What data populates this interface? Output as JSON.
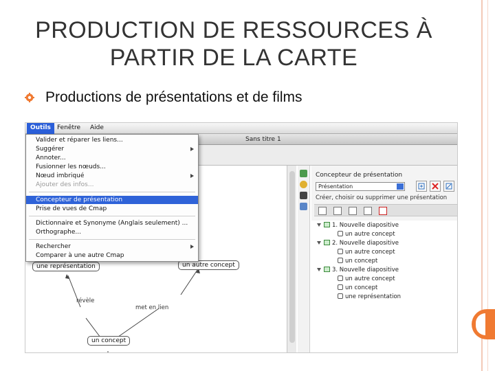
{
  "slide": {
    "title": "PRODUCTION DE RESSOURCES À PARTIR DE LA CARTE",
    "bullet": "Productions de présentations et de films",
    "accent_color": "#f07a32"
  },
  "app": {
    "menubar": {
      "items": [
        "Outils",
        "Fenêtre",
        "Aide"
      ]
    },
    "window_title": "Sans titre 1",
    "tools_menu": {
      "items": [
        "Valider et réparer les liens...",
        "Suggérer",
        "Annoter...",
        "Fusionner les nœuds...",
        "Nœud imbriqué",
        "Ajouter des infos...",
        "Concepteur de présentation",
        "Prise de vues de Cmap",
        "Dictionnaire et Synonyme (Anglais seulement) ...",
        "Orthographe...",
        "Rechercher",
        "Comparer à une autre Cmap"
      ]
    },
    "map": {
      "node_representation": "une représentation",
      "node_autre": "un autre concept",
      "node_concept": "un concept",
      "link_revele": "révèle",
      "link_met": "met en lien"
    },
    "panel": {
      "title": "Concepteur de présentation",
      "select_value": "Présentation",
      "description": "Créer, choisir ou supprimer une présentation",
      "tree": {
        "slide1": "1. Nouvelle diapositive",
        "slide1_c1": "un autre concept",
        "slide2": "2. Nouvelle diapositive",
        "slide2_c1": "un autre concept",
        "slide2_c2": "un concept",
        "slide3": "3. Nouvelle diapositive",
        "slide3_c1": "un autre concept",
        "slide3_c2": "un concept",
        "slide3_c3": "une représentation"
      }
    }
  }
}
